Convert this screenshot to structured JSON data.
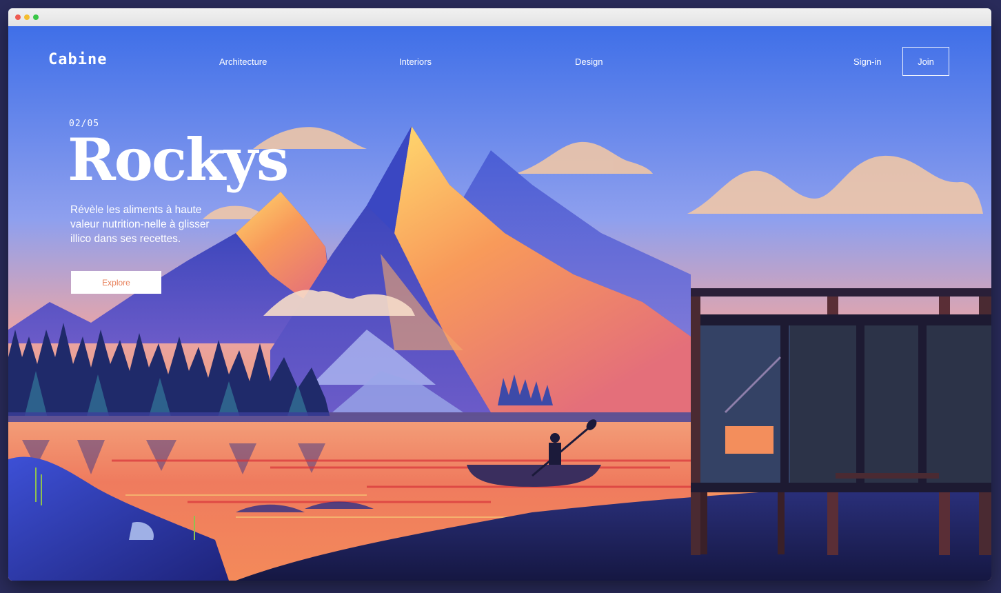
{
  "brand": {
    "logo": "Cabine"
  },
  "nav": {
    "links": [
      "Architecture",
      "Interiors",
      "Design"
    ],
    "signin": "Sign-in",
    "join": "Join"
  },
  "hero": {
    "counter": "02/05",
    "title": "Rockys",
    "description": "Révèle les aliments à haute valeur nutrition-nelle à glisser illico dans ses recettes.",
    "cta": "Explore"
  },
  "colors": {
    "sky_top": "#3f6fe8",
    "sky_bottom": "#f58d62",
    "accent": "#e7805a",
    "text": "#ffffff"
  },
  "icons": [
    "window-close-dot",
    "window-minimize-dot",
    "window-zoom-dot"
  ]
}
